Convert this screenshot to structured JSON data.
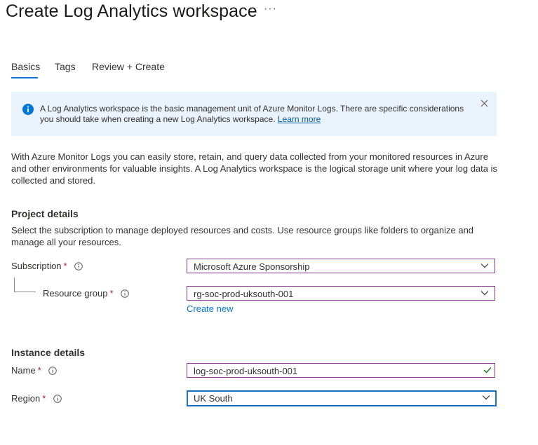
{
  "header": {
    "title": "Create Log Analytics workspace",
    "more_label": "···"
  },
  "tabs": [
    {
      "label": "Basics",
      "active": true
    },
    {
      "label": "Tags",
      "active": false
    },
    {
      "label": "Review + Create",
      "active": false
    }
  ],
  "infobar": {
    "text": "A Log Analytics workspace is the basic management unit of Azure Monitor Logs. There are specific considerations you should take when creating a new Log Analytics workspace.",
    "link": "Learn more",
    "icon": "info-icon",
    "close_icon": "close-icon"
  },
  "intro": "With Azure Monitor Logs you can easily store, retain, and query data collected from your monitored resources in Azure and other environments for valuable insights. A Log Analytics workspace is the logical storage unit where your log data is collected and stored.",
  "project": {
    "title": "Project details",
    "description": "Select the subscription to manage deployed resources and costs. Use resource groups like folders to organize and manage all your resources.",
    "subscription": {
      "label": "Subscription",
      "required": "*",
      "value": "Microsoft Azure Sponsorship"
    },
    "resource_group": {
      "label": "Resource group",
      "required": "*",
      "value": "rg-soc-prod-uksouth-001",
      "create_new": "Create new"
    }
  },
  "instance": {
    "title": "Instance details",
    "name": {
      "label": "Name",
      "required": "*",
      "value": "log-soc-prod-uksouth-001"
    },
    "region": {
      "label": "Region",
      "required": "*",
      "value": "UK South"
    }
  },
  "colors": {
    "accent": "#0078d4",
    "info_bg": "#eaf2fb",
    "required": "#a4262c",
    "valid": "#107c10",
    "dropdown_border": "#8c3b93"
  }
}
